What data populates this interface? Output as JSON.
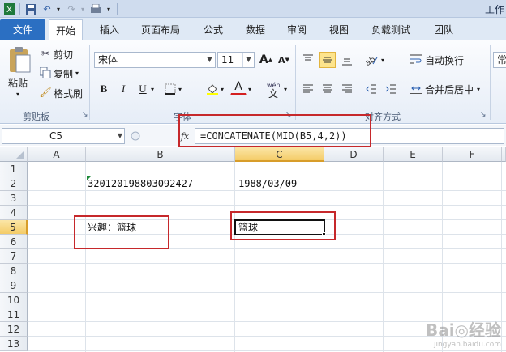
{
  "window": {
    "title": "工作"
  },
  "tabs": [
    {
      "label": "文件"
    },
    {
      "label": "开始"
    },
    {
      "label": "插入"
    },
    {
      "label": "页面布局"
    },
    {
      "label": "公式"
    },
    {
      "label": "数据"
    },
    {
      "label": "审阅"
    },
    {
      "label": "视图"
    },
    {
      "label": "负载测试"
    },
    {
      "label": "团队"
    }
  ],
  "ribbon": {
    "clipboard": {
      "paste": "粘贴",
      "cut": "剪切",
      "copy": "复制",
      "format_painter": "格式刷",
      "group_label": "剪贴板"
    },
    "font": {
      "name": "宋体",
      "size": "11",
      "group_label": "字体",
      "bold": "B",
      "italic": "I",
      "underline": "U",
      "font_color_glyph": "A",
      "grow_glyph": "A",
      "shrink_glyph": "A"
    },
    "alignment": {
      "wrap_text": "自动换行",
      "merge_center": "合并后居中",
      "group_label": "对齐方式"
    },
    "number": {
      "format": "常"
    }
  },
  "formula_bar": {
    "name_box": "C5",
    "fx": "fx",
    "formula": "=CONCATENATE(MID(B5,4,2))"
  },
  "grid": {
    "columns": [
      "A",
      "B",
      "C",
      "D",
      "E",
      "F"
    ],
    "rows": [
      "1",
      "2",
      "3",
      "4",
      "5",
      "6",
      "7",
      "8",
      "9",
      "10",
      "11",
      "12",
      "13"
    ],
    "cells": {
      "B2": "320120198803092427",
      "C2": "1988/03/09",
      "B5": "兴趣：篮球",
      "C5": "篮球"
    },
    "selected_column": "C",
    "selected_row": "5"
  },
  "watermark": {
    "brand": "Bai◎经验",
    "url": "jingyan.baidu.com"
  },
  "colors": {
    "accent": "#2b6fc2",
    "highlight": "#c6282b",
    "selection": "#f4cc68"
  }
}
